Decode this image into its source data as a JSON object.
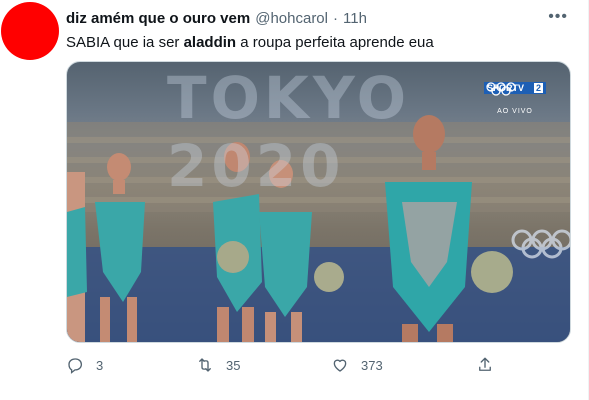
{
  "tweet": {
    "display_name": "diz amém que o ouro vem",
    "handle": "@hohcarol",
    "separator": "·",
    "time": "11h",
    "text_before": "SABIA que ia ser ",
    "text_bold": "aladdin",
    "text_after": " a roupa perfeita aprende eua",
    "avatar_color": "#ff0000",
    "more_icon": "more-icon"
  },
  "media": {
    "scene_text": "TOKYO 2020",
    "channel_brand": "SPORTV",
    "channel_number": "2",
    "live_label": "AO VIVO"
  },
  "actions": {
    "reply_count": "3",
    "retweet_count": "35",
    "like_count": "373"
  }
}
